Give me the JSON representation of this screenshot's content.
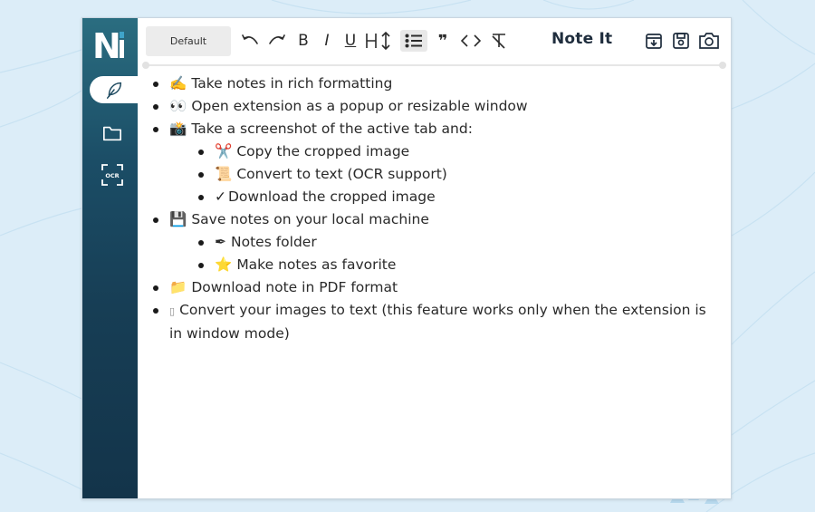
{
  "app": {
    "brand_title": "Note It",
    "logo_text": "Ni"
  },
  "sidebar": {
    "items": [
      {
        "name": "notes",
        "icon": "feather-icon",
        "active": true
      },
      {
        "name": "folder",
        "icon": "folder-icon",
        "active": false
      },
      {
        "name": "ocr",
        "icon": "ocr-icon",
        "label": "OCR",
        "active": false
      }
    ]
  },
  "toolbar": {
    "font_select": "Default",
    "tools": [
      "undo-icon",
      "redo-icon",
      "bold-icon",
      "italic-icon",
      "underline-icon",
      "heading-icon",
      "list-icon",
      "quote-icon",
      "code-icon",
      "clear-format-icon"
    ],
    "active_tool": "list-icon",
    "right_tools": [
      "archive-icon",
      "save-icon",
      "camera-icon"
    ]
  },
  "editor": {
    "items": [
      {
        "emoji": "✍️",
        "text": "Take notes in rich formatting"
      },
      {
        "emoji": "👀",
        "text": "Open extension as a popup or resizable window"
      },
      {
        "emoji": "📸",
        "text": "Take a screenshot of the active tab and:",
        "children": [
          {
            "emoji": "✂️",
            "text": "Copy the cropped image"
          },
          {
            "emoji": "📜",
            "text": "Convert to text (OCR support)"
          },
          {
            "emoji": "✓",
            "text": "Download the cropped image"
          }
        ]
      },
      {
        "emoji": "💾",
        "text": "Save notes on your local machine",
        "children": [
          {
            "emoji": "✒",
            "text": "Notes folder"
          },
          {
            "emoji": "⭐",
            "text": "Make notes as favorite"
          }
        ]
      },
      {
        "emoji": "📁",
        "text": "Download note in PDF format"
      },
      {
        "emoji": "▯",
        "text": "Convert your images to text (this feature works only when the extension is in window mode)"
      }
    ]
  },
  "colors": {
    "background": "#dcedf8",
    "sidebar_top": "#2a6d80",
    "sidebar_bottom": "#13344a",
    "logo_accent": "#3fa4c9"
  }
}
